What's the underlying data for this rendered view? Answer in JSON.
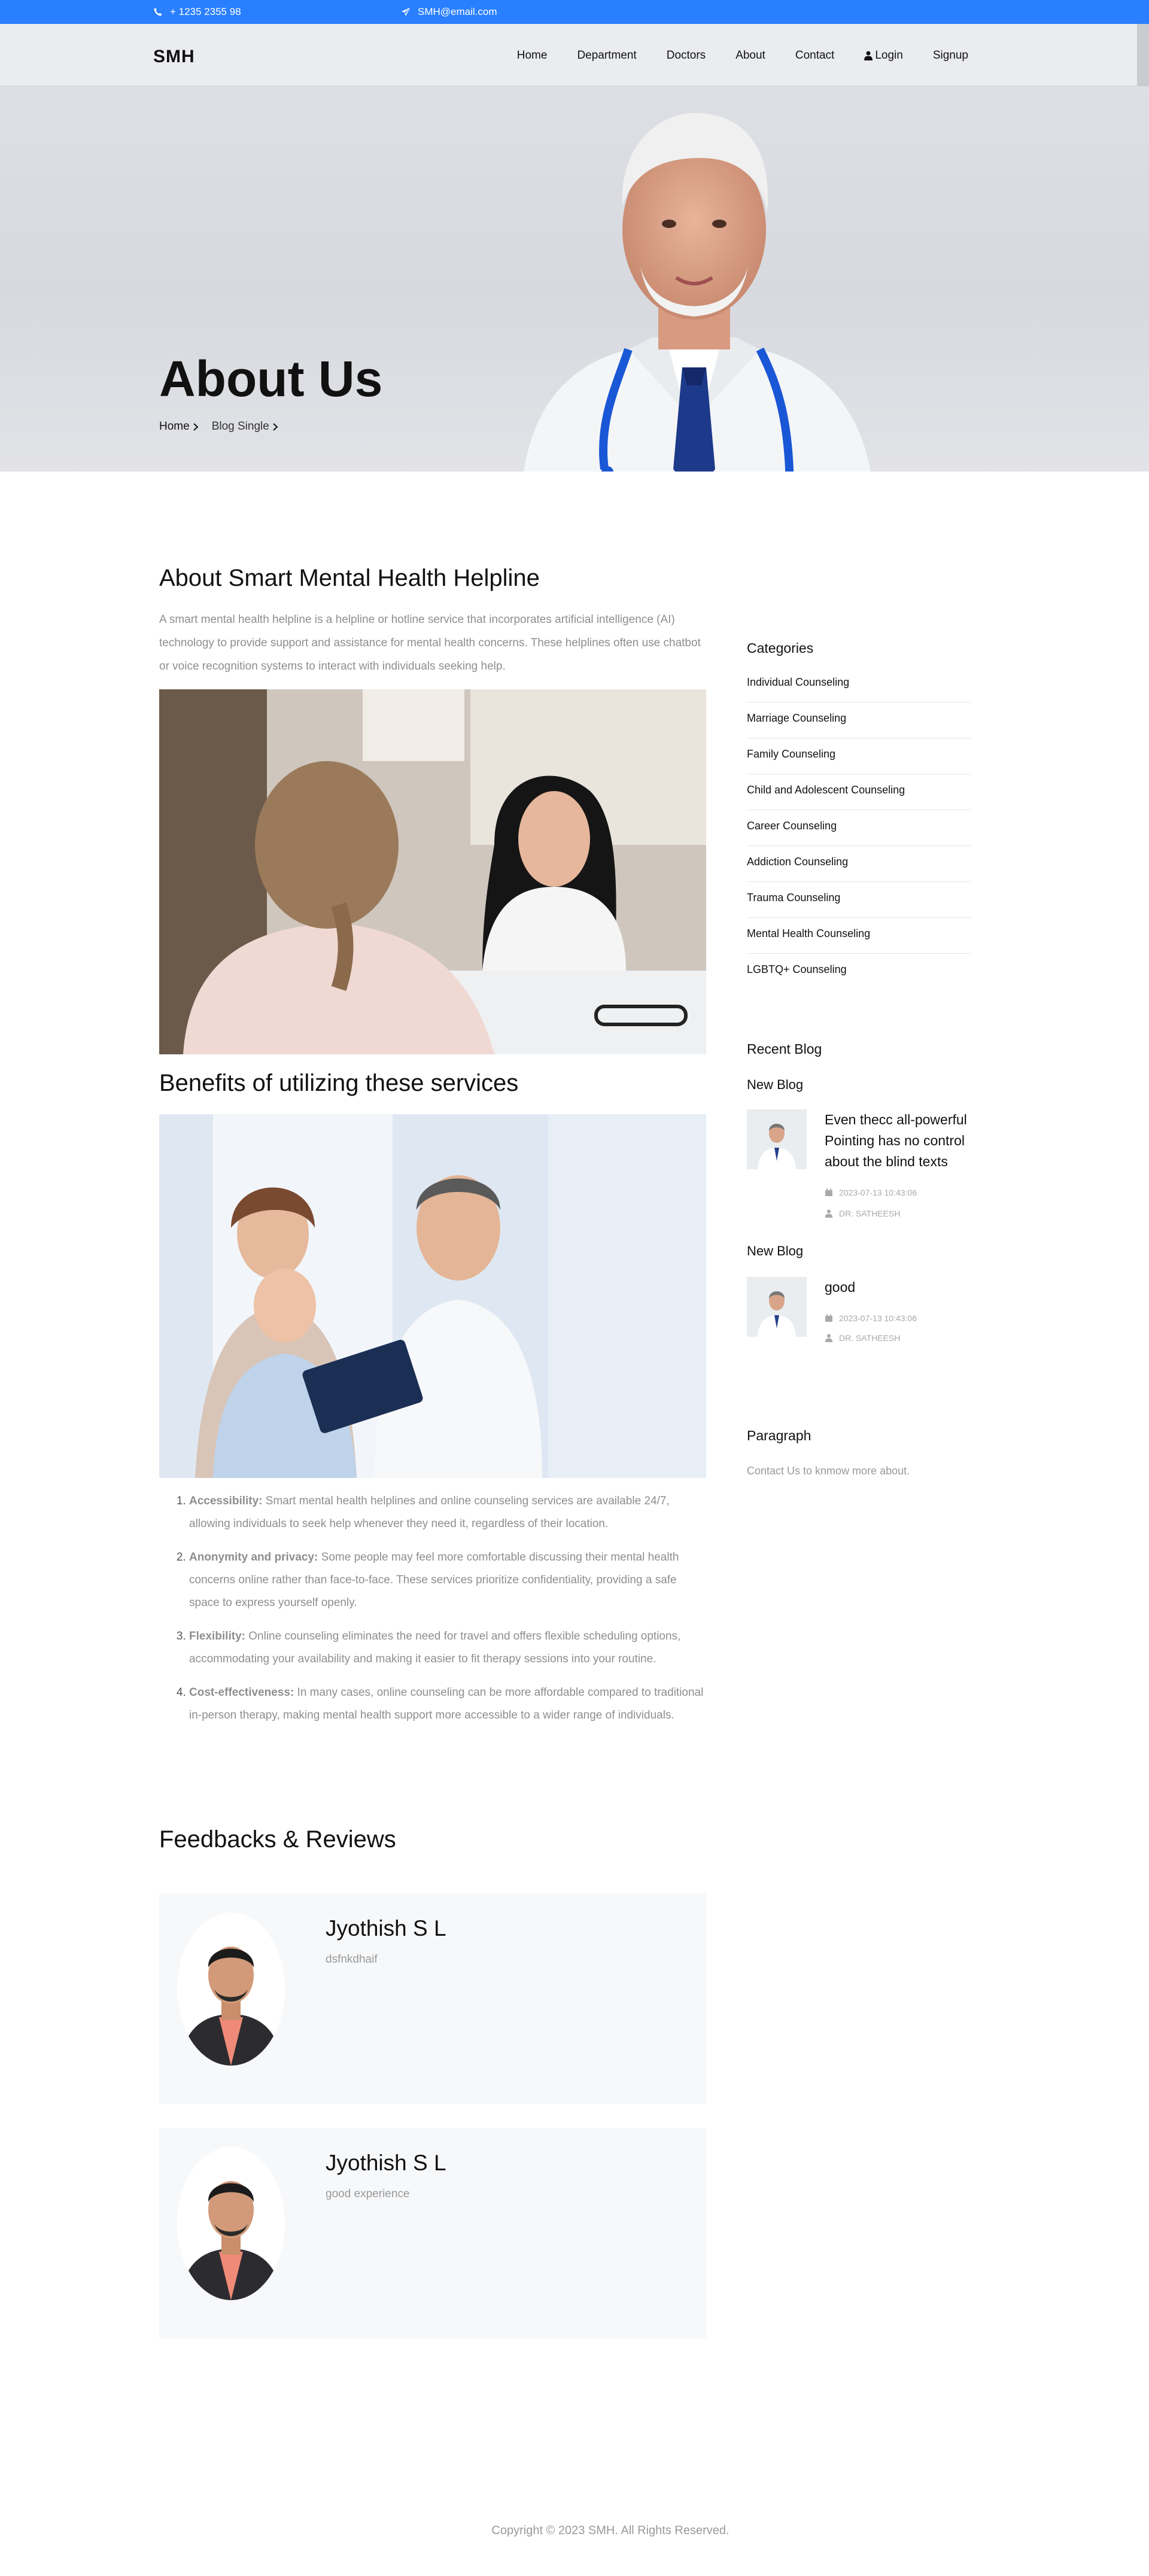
{
  "topbar": {
    "phone": "+ 1235 2355 98",
    "email": "SMH@email.com"
  },
  "header": {
    "brand": "SMH",
    "nav": [
      "Home",
      "Department",
      "Doctors",
      "About",
      "Contact",
      "Login",
      "Signup"
    ]
  },
  "hero": {
    "title": "About Us",
    "breadcrumbs": [
      "Home",
      "Blog Single"
    ]
  },
  "main": {
    "title": "About Smart Mental Health Helpline",
    "intro": "A smart mental health helpline is a helpline or hotline service that incorporates artificial intelligence (AI) technology to provide support and assistance for mental health concerns. These helplines often use chatbot or voice recognition systems to interact with individuals seeking help.",
    "benefits_title": "Benefits of utilizing these services",
    "benefits": [
      {
        "term": "Accessibility:",
        "text": " Smart mental health helplines and online counseling services are available 24/7, allowing individuals to seek help whenever they need it, regardless of their location."
      },
      {
        "term": "Anonymity and privacy:",
        "text": " Some people may feel more comfortable discussing their mental health concerns online rather than face-to-face. These services prioritize confidentiality, providing a safe space to express yourself openly."
      },
      {
        "term": "Flexibility:",
        "text": " Online counseling eliminates the need for travel and offers flexible scheduling options, accommodating your availability and making it easier to fit therapy sessions into your routine."
      },
      {
        "term": "Cost-effectiveness:",
        "text": " In many cases, online counseling can be more affordable compared to traditional in-person therapy, making mental health support more accessible to a wider range of individuals."
      }
    ],
    "feedback_title": "Feedbacks & Reviews"
  },
  "sidebar": {
    "categories_title": "Categories",
    "categories": [
      "Individual Counseling",
      "Marriage Counseling",
      "Family Counseling",
      "Child and Adolescent Counseling",
      "Career Counseling",
      "Addiction Counseling",
      "Trauma Counseling",
      "Mental Health Counseling",
      "LGBTQ+ Counseling"
    ],
    "recent_title": "Recent Blog",
    "blogs": [
      {
        "label": "New Blog",
        "title": "Even thecc all-powerful Pointing has no control about the blind texts",
        "date": "2023-07-13 10:43:06",
        "author": "DR. SATHEESH"
      },
      {
        "label": "New Blog",
        "title": "good",
        "date": "2023-07-13 10:43:06",
        "author": "DR. SATHEESH"
      }
    ],
    "paragraph_title": "Paragraph",
    "paragraph_text": "Contact Us to knmow more about."
  },
  "reviews": [
    {
      "name": "Jyothish S L",
      "text": "dsfnkdhaif"
    },
    {
      "name": "Jyothish S L",
      "text": "good experience"
    }
  ],
  "footer": {
    "copyright": "Copyright © 2023 SMH. All Rights Reserved."
  },
  "colors": {
    "topbar": "#2a7fff",
    "muted_text": "#8e8e8e"
  },
  "icons": [
    "phone-icon",
    "paper-plane-icon",
    "user-icon",
    "chevron-right-icon",
    "calendar-icon"
  ]
}
